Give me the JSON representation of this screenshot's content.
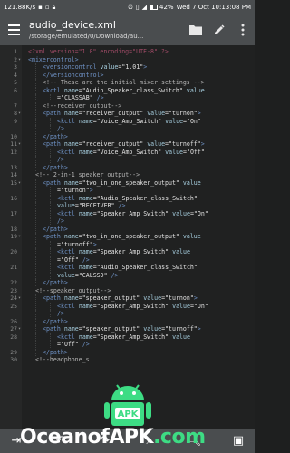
{
  "status_bar": {
    "speed": "121.88K/s",
    "date_time": "Wed 7 Oct 10:13:08 PM",
    "battery": "42%"
  },
  "app_bar": {
    "title": "audio_device.xml",
    "subtitle": "/storage/emulated/0/Download/au..."
  },
  "editor": {
    "lines": [
      {
        "n": "1",
        "fold": "",
        "indent": 0,
        "html": "<span class='pi'>&lt;?xml version=\"1.0\" encoding=\"UTF-8\" ?&gt;</span>"
      },
      {
        "n": "2",
        "fold": "▾",
        "indent": 0,
        "html": "<span class='tag'>&lt;mixercontrol&gt;</span>"
      },
      {
        "n": "3",
        "fold": "",
        "indent": 4,
        "html": "<span class='tag'>&lt;versioncontrol</span> <span class='attr'>value</span><span class='str'>=\"1.01\"</span><span class='tag'>&gt;</span>"
      },
      {
        "n": "4",
        "fold": "",
        "indent": 4,
        "html": "<span class='tag'>&lt;/versioncontrol&gt;</span>"
      },
      {
        "n": "5",
        "fold": "",
        "indent": 4,
        "html": "<span class='cmt'>&lt;!-- These are the initial mixer settings --&gt;</span>"
      },
      {
        "n": "6",
        "fold": "",
        "indent": 4,
        "html": "<span class='tag'>&lt;kctl</span> <span class='attr'>name</span><span class='str'>=\"Audio_Speaker_class_Switch\"</span> <span class='attr'>value</span>"
      },
      {
        "n": "",
        "fold": "",
        "indent": 8,
        "html": "<span class='str'>=\"CLASSAB\"</span> <span class='tag'>/&gt;</span>"
      },
      {
        "n": "7",
        "fold": "",
        "indent": 4,
        "html": "<span class='cmt'>&lt;!--receiver output--&gt;</span>"
      },
      {
        "n": "8",
        "fold": "▾",
        "indent": 4,
        "html": "<span class='tag'>&lt;path</span> <span class='attr'>name</span><span class='str'>=\"receiver_output\"</span> <span class='attr'>value</span><span class='str'>=\"turnon\"</span><span class='tag'>&gt;</span>"
      },
      {
        "n": "9",
        "fold": "",
        "indent": 8,
        "html": "<span class='tag'>&lt;kctl</span> <span class='attr'>name</span><span class='str'>=\"Voice_Amp_Switch\"</span> <span class='attr'>value</span><span class='str'>=\"On\"</span>"
      },
      {
        "n": "",
        "fold": "",
        "indent": 8,
        "html": "<span class='tag'>/&gt;</span>"
      },
      {
        "n": "10",
        "fold": "",
        "indent": 4,
        "html": "<span class='tag'>&lt;/path&gt;</span>"
      },
      {
        "n": "11",
        "fold": "▾",
        "indent": 4,
        "html": "<span class='tag'>&lt;path</span> <span class='attr'>name</span><span class='str'>=\"receiver_output\"</span> <span class='attr'>value</span><span class='str'>=\"turnoff\"</span><span class='tag'>&gt;</span>"
      },
      {
        "n": "12",
        "fold": "",
        "indent": 8,
        "html": "<span class='tag'>&lt;kctl</span> <span class='attr'>name</span><span class='str'>=\"Voice_Amp_Switch\"</span> <span class='attr'>value</span><span class='str'>=\"Off\"</span>"
      },
      {
        "n": "",
        "fold": "",
        "indent": 8,
        "html": "<span class='tag'>/&gt;</span>"
      },
      {
        "n": "13",
        "fold": "",
        "indent": 4,
        "html": "<span class='tag'>&lt;/path&gt;</span>"
      },
      {
        "n": "14",
        "fold": "",
        "indent": 2,
        "html": "<span class='cmt'>&lt;!-- 2-in-1 speaker output--&gt;</span>"
      },
      {
        "n": "15",
        "fold": "▾",
        "indent": 4,
        "html": "<span class='tag'>&lt;path</span> <span class='attr'>name</span><span class='str'>=\"two_in_one_speaker_output\"</span> <span class='attr'>value</span>"
      },
      {
        "n": "",
        "fold": "",
        "indent": 8,
        "html": "<span class='str'>=\"turnon\"</span><span class='tag'>&gt;</span>"
      },
      {
        "n": "16",
        "fold": "",
        "indent": 8,
        "html": "<span class='tag'>&lt;kctl</span> <span class='attr'>name</span><span class='str'>=\"Audio_Speaker_class_Switch\"</span>"
      },
      {
        "n": "",
        "fold": "",
        "indent": 8,
        "html": "<span class='attr'>value</span><span class='str'>=\"RECEIVER\"</span> <span class='tag'>/&gt;</span>"
      },
      {
        "n": "17",
        "fold": "",
        "indent": 8,
        "html": "<span class='tag'>&lt;kctl</span> <span class='attr'>name</span><span class='str'>=\"Speaker_Amp_Switch\"</span> <span class='attr'>value</span><span class='str'>=\"On\"</span>"
      },
      {
        "n": "",
        "fold": "",
        "indent": 8,
        "html": "<span class='tag'>/&gt;</span>"
      },
      {
        "n": "18",
        "fold": "",
        "indent": 4,
        "html": "<span class='tag'>&lt;/path&gt;</span>"
      },
      {
        "n": "19",
        "fold": "▾",
        "indent": 4,
        "html": "<span class='tag'>&lt;path</span> <span class='attr'>name</span><span class='str'>=\"two_in_one_speaker_output\"</span> <span class='attr'>value</span>"
      },
      {
        "n": "",
        "fold": "",
        "indent": 8,
        "html": "<span class='str'>=\"turnoff\"</span><span class='tag'>&gt;</span>"
      },
      {
        "n": "20",
        "fold": "",
        "indent": 8,
        "html": "<span class='tag'>&lt;kctl</span> <span class='attr'>name</span><span class='str'>=\"Speaker_Amp_Switch\"</span> <span class='attr'>value</span>"
      },
      {
        "n": "",
        "fold": "",
        "indent": 8,
        "html": "<span class='str'>=\"Off\"</span> <span class='tag'>/&gt;</span>"
      },
      {
        "n": "21",
        "fold": "",
        "indent": 8,
        "html": "<span class='tag'>&lt;kctl</span> <span class='attr'>name</span><span class='str'>=\"Audio_Speaker_class_Switch\"</span>"
      },
      {
        "n": "",
        "fold": "",
        "indent": 8,
        "html": "<span class='attr'>value</span><span class='str'>=\"CALSSD\"</span> <span class='tag'>/&gt;</span>"
      },
      {
        "n": "22",
        "fold": "",
        "indent": 4,
        "html": "<span class='tag'>&lt;/path&gt;</span>"
      },
      {
        "n": "23",
        "fold": "",
        "indent": 2,
        "html": "<span class='cmt'>&lt;!--speaker output--&gt;</span>"
      },
      {
        "n": "24",
        "fold": "▾",
        "indent": 4,
        "html": "<span class='tag'>&lt;path</span> <span class='attr'>name</span><span class='str'>=\"speaker_output\"</span> <span class='attr'>value</span><span class='str'>=\"turnon\"</span><span class='tag'>&gt;</span>"
      },
      {
        "n": "25",
        "fold": "",
        "indent": 8,
        "html": "<span class='tag'>&lt;kctl</span> <span class='attr'>name</span><span class='str'>=\"Speaker_Amp_Switch\"</span> <span class='attr'>value</span><span class='str'>=\"On\"</span>"
      },
      {
        "n": "",
        "fold": "",
        "indent": 8,
        "html": "<span class='tag'>/&gt;</span>"
      },
      {
        "n": "26",
        "fold": "",
        "indent": 4,
        "html": "<span class='tag'>&lt;/path&gt;</span>"
      },
      {
        "n": "27",
        "fold": "▾",
        "indent": 4,
        "html": "<span class='tag'>&lt;path</span> <span class='attr'>name</span><span class='str'>=\"speaker_output\"</span> <span class='attr'>value</span><span class='str'>=\"turnoff\"</span><span class='tag'>&gt;</span>"
      },
      {
        "n": "28",
        "fold": "",
        "indent": 8,
        "html": "<span class='tag'>&lt;kctl</span> <span class='attr'>name</span><span class='str'>=\"Speaker_Amp_Switch\"</span> <span class='attr'>value</span>"
      },
      {
        "n": "",
        "fold": "",
        "indent": 8,
        "html": "<span class='str'>=\"Off\"</span> <span class='tag'>/&gt;</span>"
      },
      {
        "n": "29",
        "fold": "",
        "indent": 4,
        "html": "<span class='tag'>&lt;/path&gt;</span>"
      },
      {
        "n": "30",
        "fold": "",
        "indent": 2,
        "html": "<span class='cmt'>&lt;!--headphone_s</span>"
      }
    ]
  },
  "watermark": {
    "badge_text": "APK",
    "text_part1": "OceanofAPK",
    "text_part2": ".com"
  }
}
